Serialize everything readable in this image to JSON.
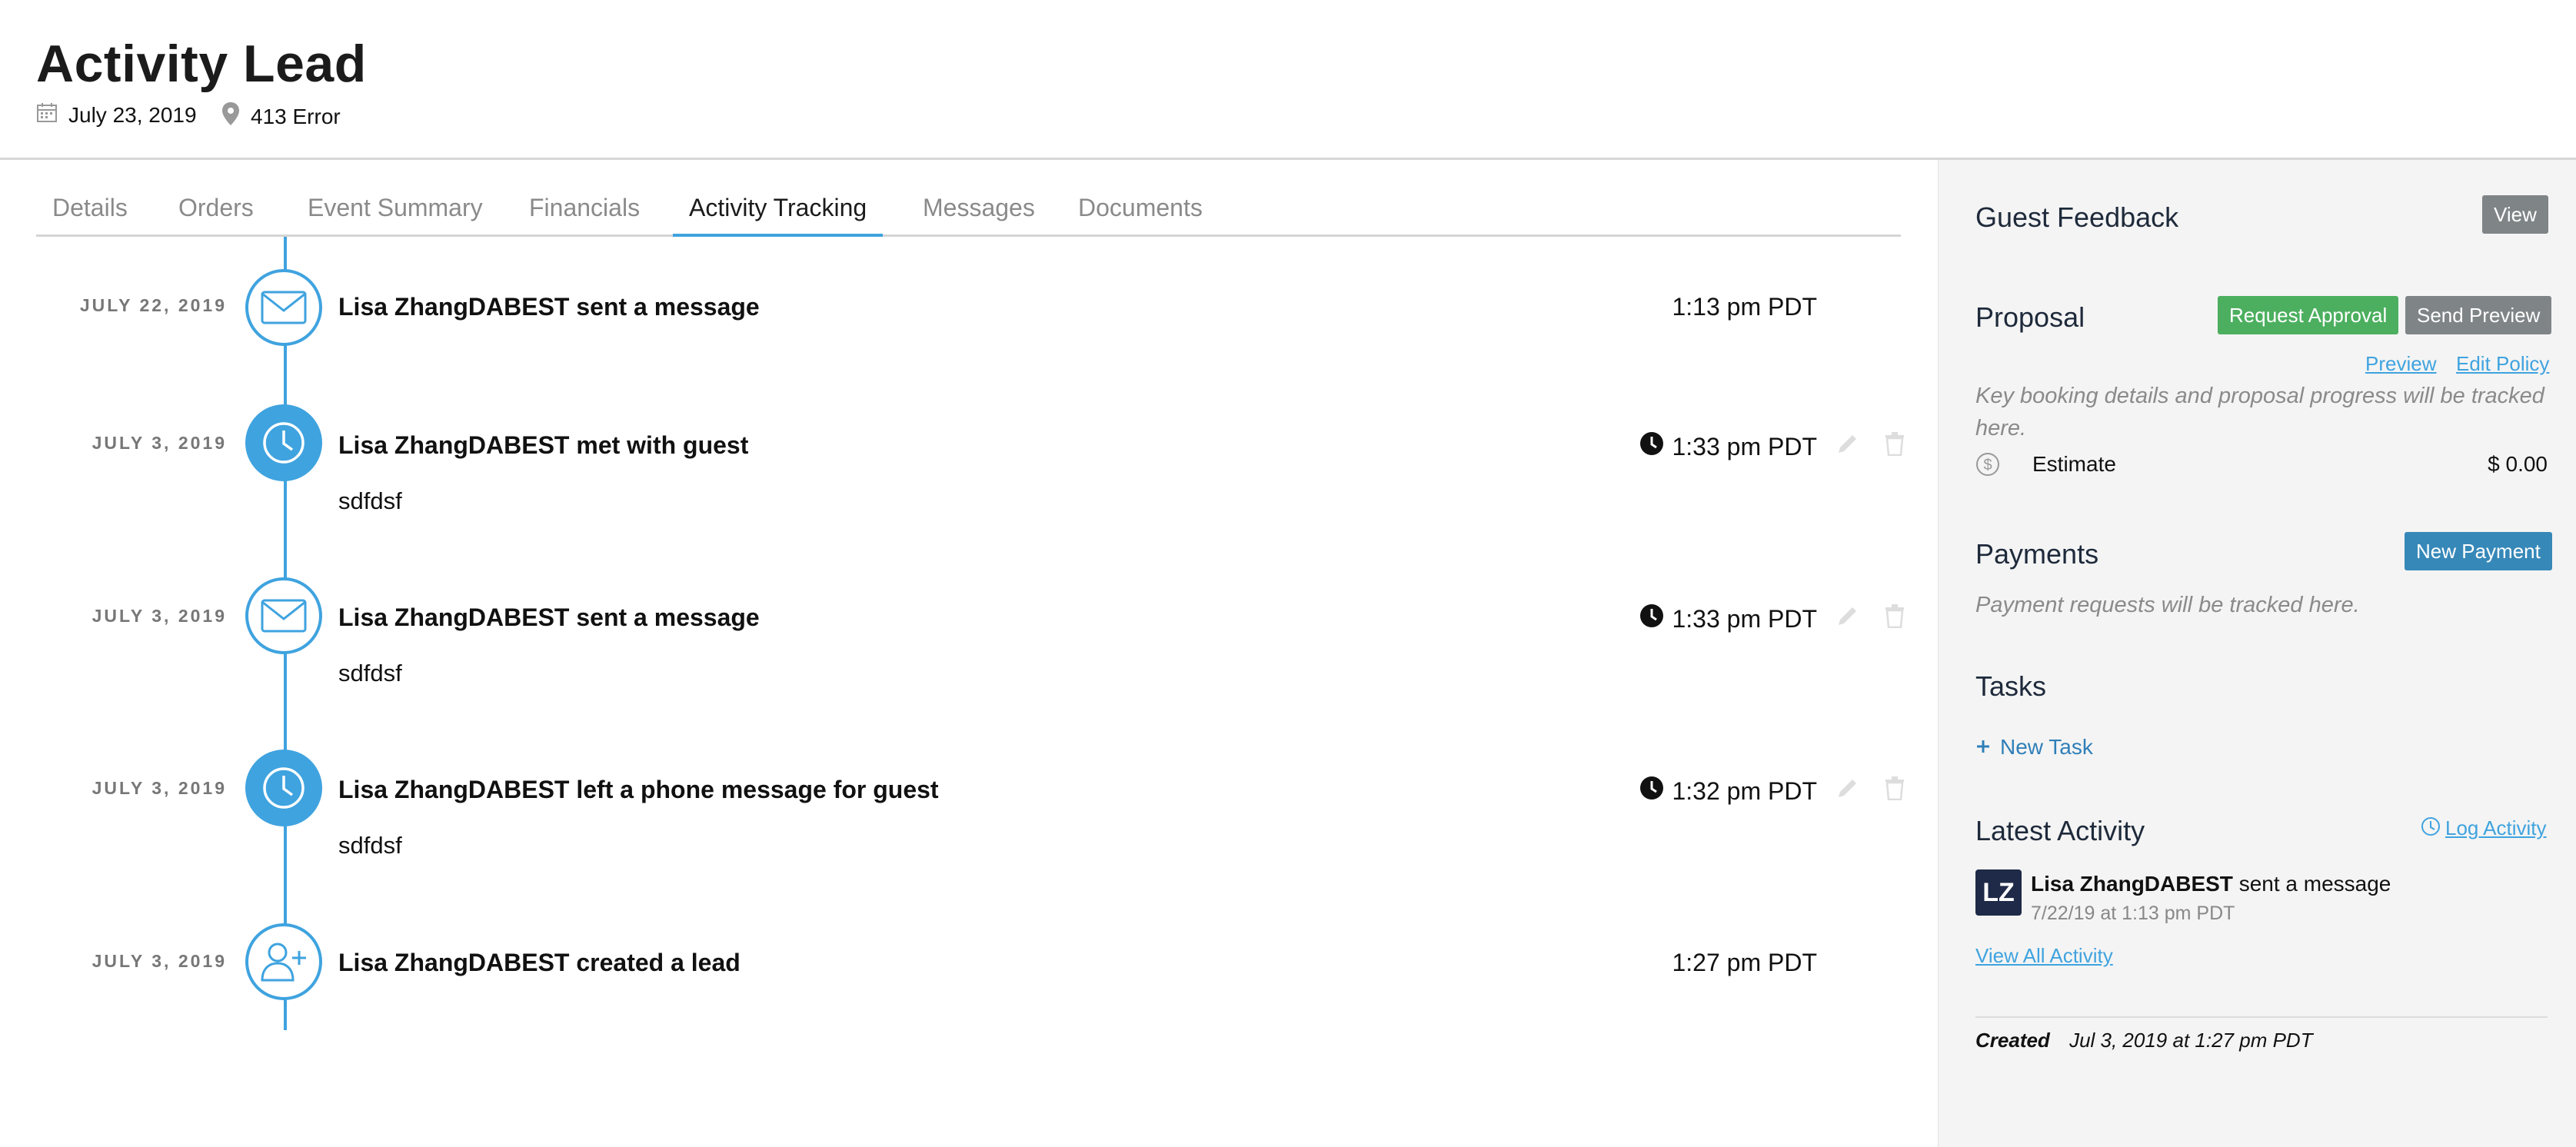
{
  "header": {
    "title": "Activity Lead",
    "date": "July 23, 2019",
    "location": "413 Error",
    "icons": [
      "calendar-icon",
      "map-pin-icon"
    ]
  },
  "tabs": [
    {
      "label": "Details"
    },
    {
      "label": "Orders"
    },
    {
      "label": "Event Summary"
    },
    {
      "label": "Financials"
    },
    {
      "label": "Activity Tracking",
      "active": true
    },
    {
      "label": "Messages"
    },
    {
      "label": "Documents"
    }
  ],
  "timeline": [
    {
      "date": "JULY 22, 2019",
      "icon": "envelope-icon",
      "title": "Lisa ZhangDABEST sent a message",
      "time": "1:13 pm PDT",
      "body": ""
    },
    {
      "date": "JULY 3, 2019",
      "icon": "clock-icon",
      "title": "Lisa ZhangDABEST met with guest",
      "time": "1:33 pm PDT",
      "body": "sdfdsf"
    },
    {
      "date": "JULY 3, 2019",
      "icon": "envelope-icon",
      "title": "Lisa ZhangDABEST sent a message",
      "time": "1:33 pm PDT",
      "body": "sdfdsf"
    },
    {
      "date": "JULY 3, 2019",
      "icon": "clock-icon",
      "title": "Lisa ZhangDABEST left a phone message for guest",
      "time": "1:32 pm PDT",
      "body": "sdfdsf"
    },
    {
      "date": "JULY 3, 2019",
      "icon": "user-plus-icon",
      "title": "Lisa ZhangDABEST created a lead",
      "time": "1:27 pm PDT",
      "body": ""
    }
  ],
  "sidebar": {
    "guest_feedback": {
      "title": "Guest Feedback",
      "view_label": "View"
    },
    "proposal": {
      "title": "Proposal",
      "request_label": "Request Approval",
      "send_label": "Send Preview",
      "preview_link": "Preview",
      "edit_policy_link": "Edit Policy",
      "note": "Key booking details and proposal progress will be tracked here.",
      "estimate_label": "Estimate",
      "estimate_value": "$ 0.00"
    },
    "payments": {
      "title": "Payments",
      "new_payment_label": "New Payment",
      "note": "Payment requests will be tracked here."
    },
    "tasks": {
      "title": "Tasks",
      "new_task_label": "New Task"
    },
    "latest_activity": {
      "title": "Latest Activity",
      "log_link": "Log Activity",
      "avatar_initials": "LZ",
      "actor": "Lisa ZhangDABEST",
      "action": "sent a message",
      "timestamp": "7/22/19 at 1:13 pm PDT",
      "view_all": "View All Activity"
    },
    "created": {
      "label": "Created",
      "value": "Jul 3, 2019 at 1:27 pm PDT"
    }
  },
  "colors": {
    "accent": "#3fa3df",
    "green_button": "#4caf5f",
    "blue_button": "#3688b8",
    "gray_button": "#7f8487",
    "sidebar_bg": "#f4f4f4"
  }
}
